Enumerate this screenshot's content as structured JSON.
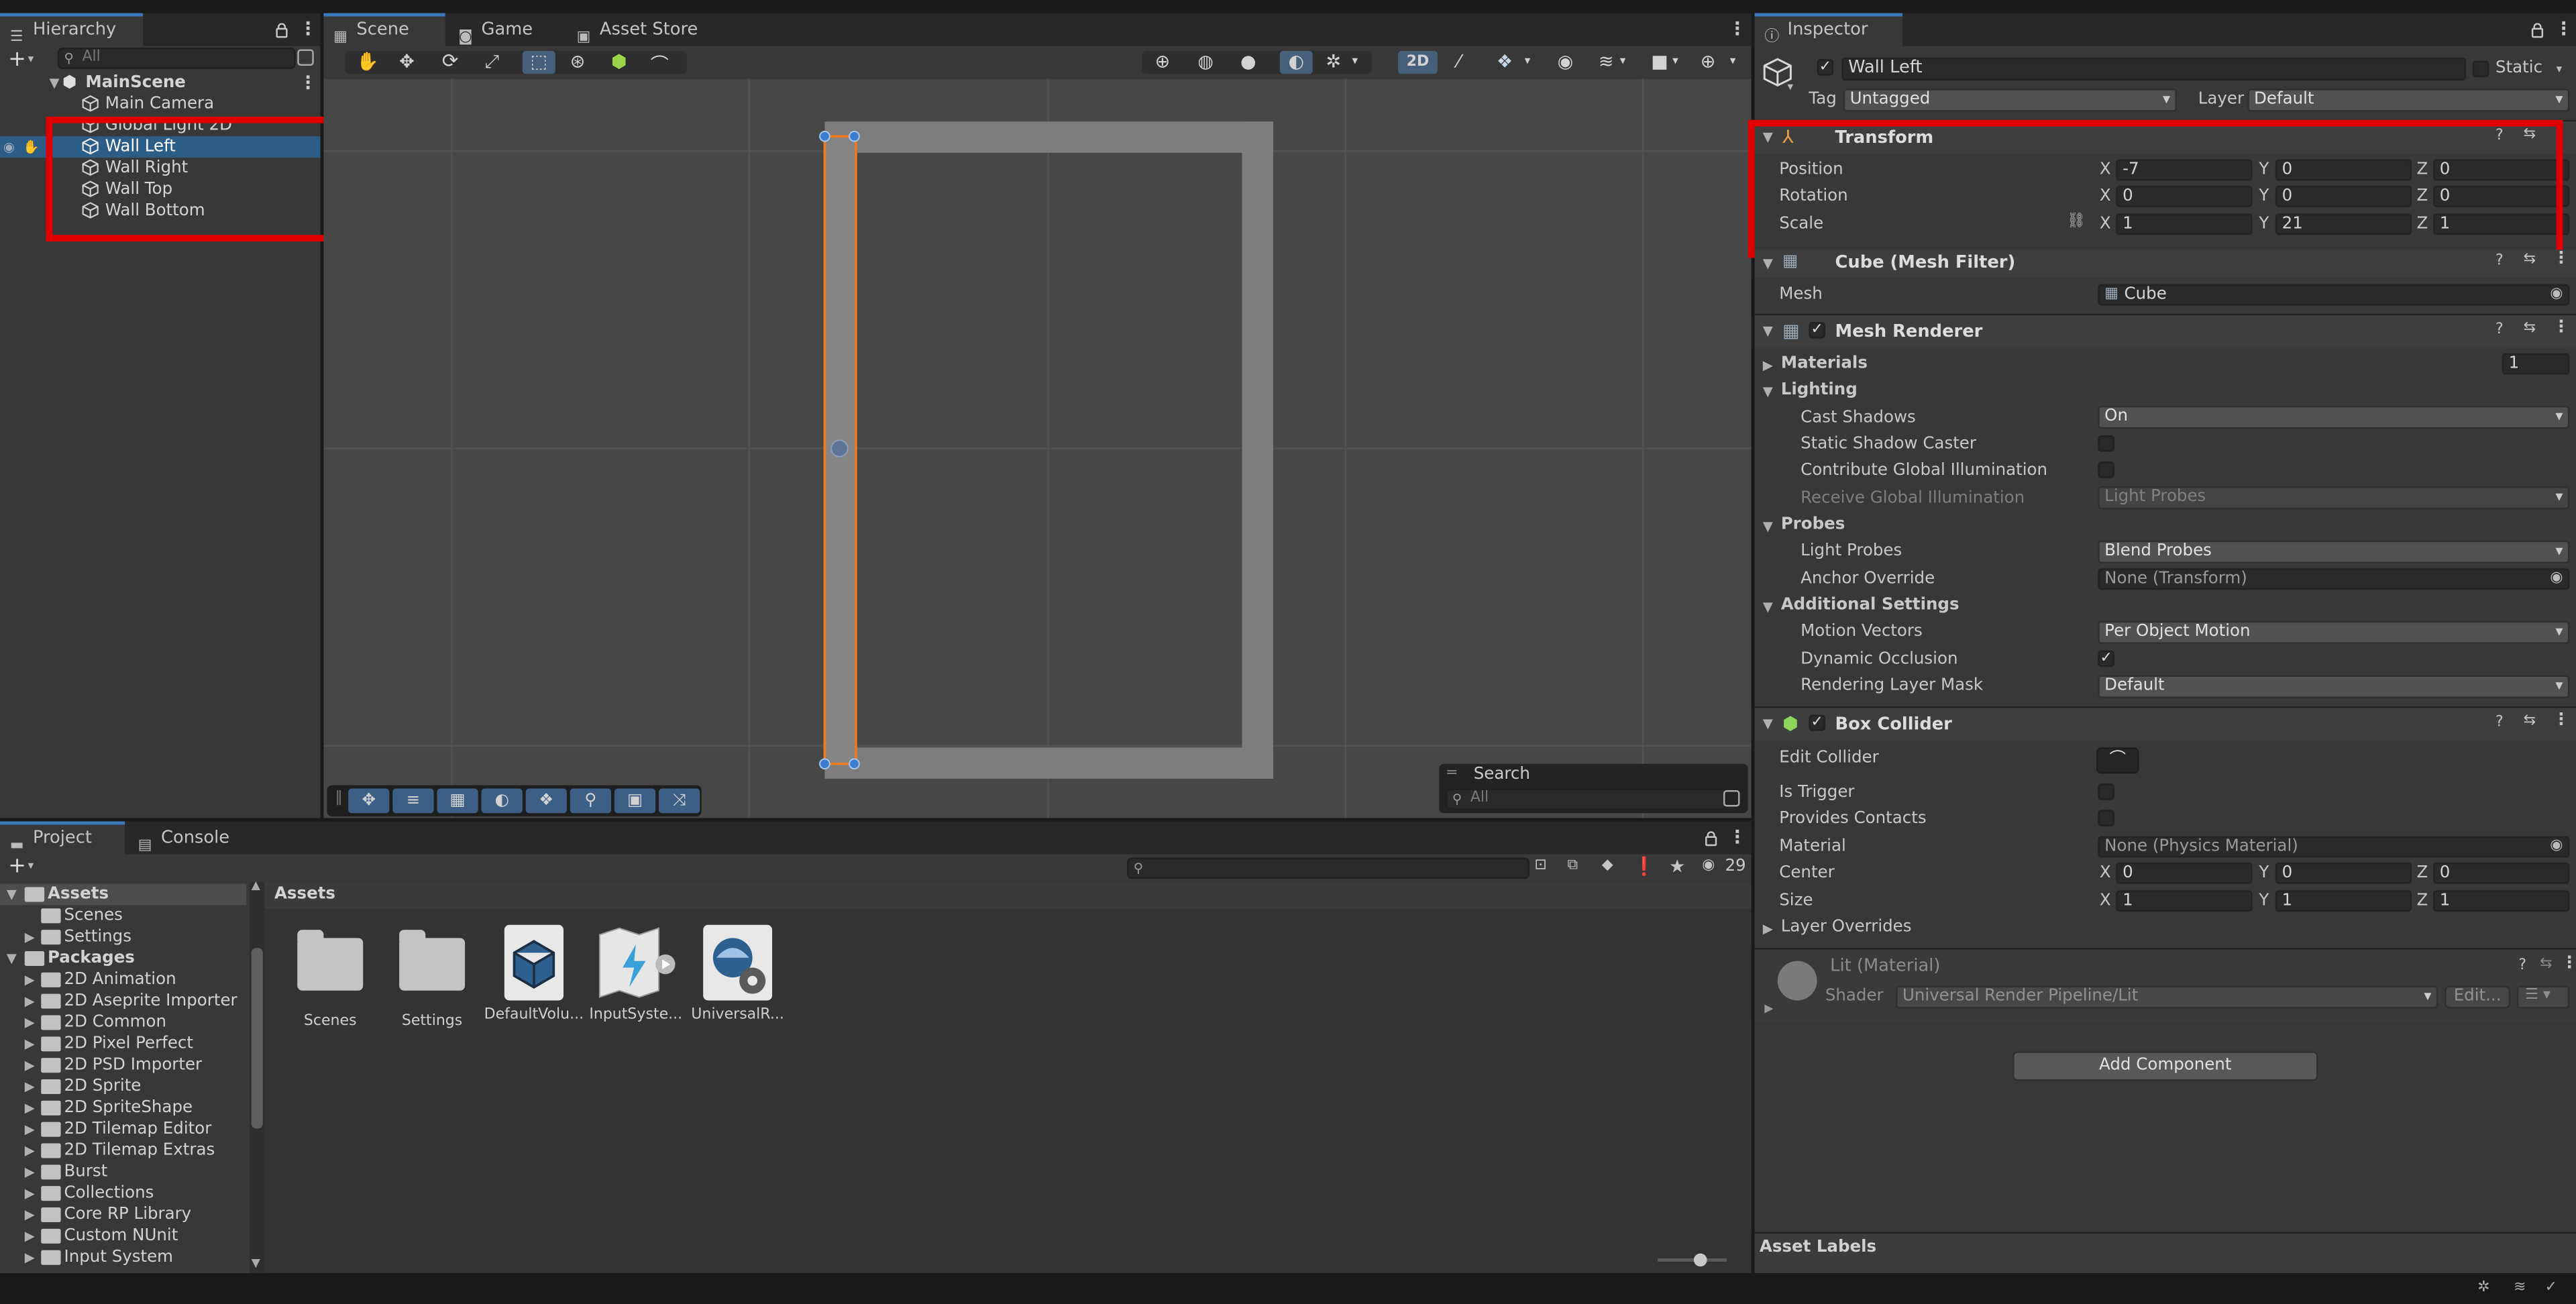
{
  "hierarchy": {
    "tab": "Hierarchy",
    "search_placeholder": "All",
    "scene": "MainScene",
    "items": [
      "Main Camera",
      "Global Light 2D",
      "Wall Left",
      "Wall Right",
      "Wall Top",
      "Wall Bottom"
    ],
    "selected": "Wall Left"
  },
  "center_tabs": {
    "scene": "Scene",
    "game": "Game",
    "asset_store": "Asset Store"
  },
  "scene_toolbar": {
    "mode_2d": "2D"
  },
  "scene_search": {
    "title": "Search",
    "placeholder": "All"
  },
  "inspector": {
    "tab": "Inspector",
    "object_name": "Wall Left",
    "static_label": "Static",
    "tag_label": "Tag",
    "tag_value": "Untagged",
    "layer_label": "Layer",
    "layer_value": "Default",
    "transform": {
      "title": "Transform",
      "position_label": "Position",
      "position": {
        "x": "-7",
        "y": "0",
        "z": "0"
      },
      "rotation_label": "Rotation",
      "rotation": {
        "x": "0",
        "y": "0",
        "z": "0"
      },
      "scale_label": "Scale",
      "scale": {
        "x": "1",
        "y": "21",
        "z": "1"
      }
    },
    "mesh_filter": {
      "title": "Cube (Mesh Filter)",
      "mesh_label": "Mesh",
      "mesh_value": "Cube"
    },
    "mesh_renderer": {
      "title": "Mesh Renderer",
      "materials_label": "Materials",
      "materials_count": "1",
      "lighting_label": "Lighting",
      "cast_shadows_label": "Cast Shadows",
      "cast_shadows_value": "On",
      "static_shadow_label": "Static Shadow Caster",
      "contribute_gi_label": "Contribute Global Illumination",
      "receive_gi_label": "Receive Global Illumination",
      "receive_gi_value": "Light Probes",
      "probes_label": "Probes",
      "light_probes_label": "Light Probes",
      "light_probes_value": "Blend Probes",
      "anchor_label": "Anchor Override",
      "anchor_value": "None (Transform)",
      "additional_label": "Additional Settings",
      "motion_vectors_label": "Motion Vectors",
      "motion_vectors_value": "Per Object Motion",
      "dynamic_occlusion_label": "Dynamic Occlusion",
      "rendering_layer_label": "Rendering Layer Mask",
      "rendering_layer_value": "Default"
    },
    "box_collider": {
      "title": "Box Collider",
      "edit_label": "Edit Collider",
      "trigger_label": "Is Trigger",
      "contacts_label": "Provides Contacts",
      "material_label": "Material",
      "material_value": "None (Physics Material)",
      "center_label": "Center",
      "center": {
        "x": "0",
        "y": "0",
        "z": "0"
      },
      "size_label": "Size",
      "size": {
        "x": "1",
        "y": "1",
        "z": "1"
      },
      "layer_overrides_label": "Layer Overrides"
    },
    "material": {
      "title": "Lit (Material)",
      "shader_label": "Shader",
      "shader_value": "Universal Render Pipeline/Lit",
      "edit_label": "Edit..."
    },
    "add_component": "Add Component",
    "asset_labels": "Asset Labels"
  },
  "project": {
    "tab_project": "Project",
    "tab_console": "Console",
    "count": "29",
    "breadcrumb": "Assets",
    "tree_assets": "Assets",
    "tree_asset_children": [
      "Scenes",
      "Settings"
    ],
    "tree_packages": "Packages",
    "packages": [
      "2D Animation",
      "2D Aseprite Importer",
      "2D Common",
      "2D Pixel Perfect",
      "2D PSD Importer",
      "2D Sprite",
      "2D SpriteShape",
      "2D Tilemap Editor",
      "2D Tilemap Extras",
      "Burst",
      "Collections",
      "Core RP Library",
      "Custom NUnit",
      "Input System"
    ],
    "assets": [
      "Scenes",
      "Settings",
      "DefaultVolu...",
      "InputSyste...",
      "UniversalR..."
    ]
  },
  "colors": {
    "accent": "#3a79bb",
    "selection": "#2c5d87",
    "highlight": "#e00000",
    "gizmo_orange": "#f07a20"
  }
}
